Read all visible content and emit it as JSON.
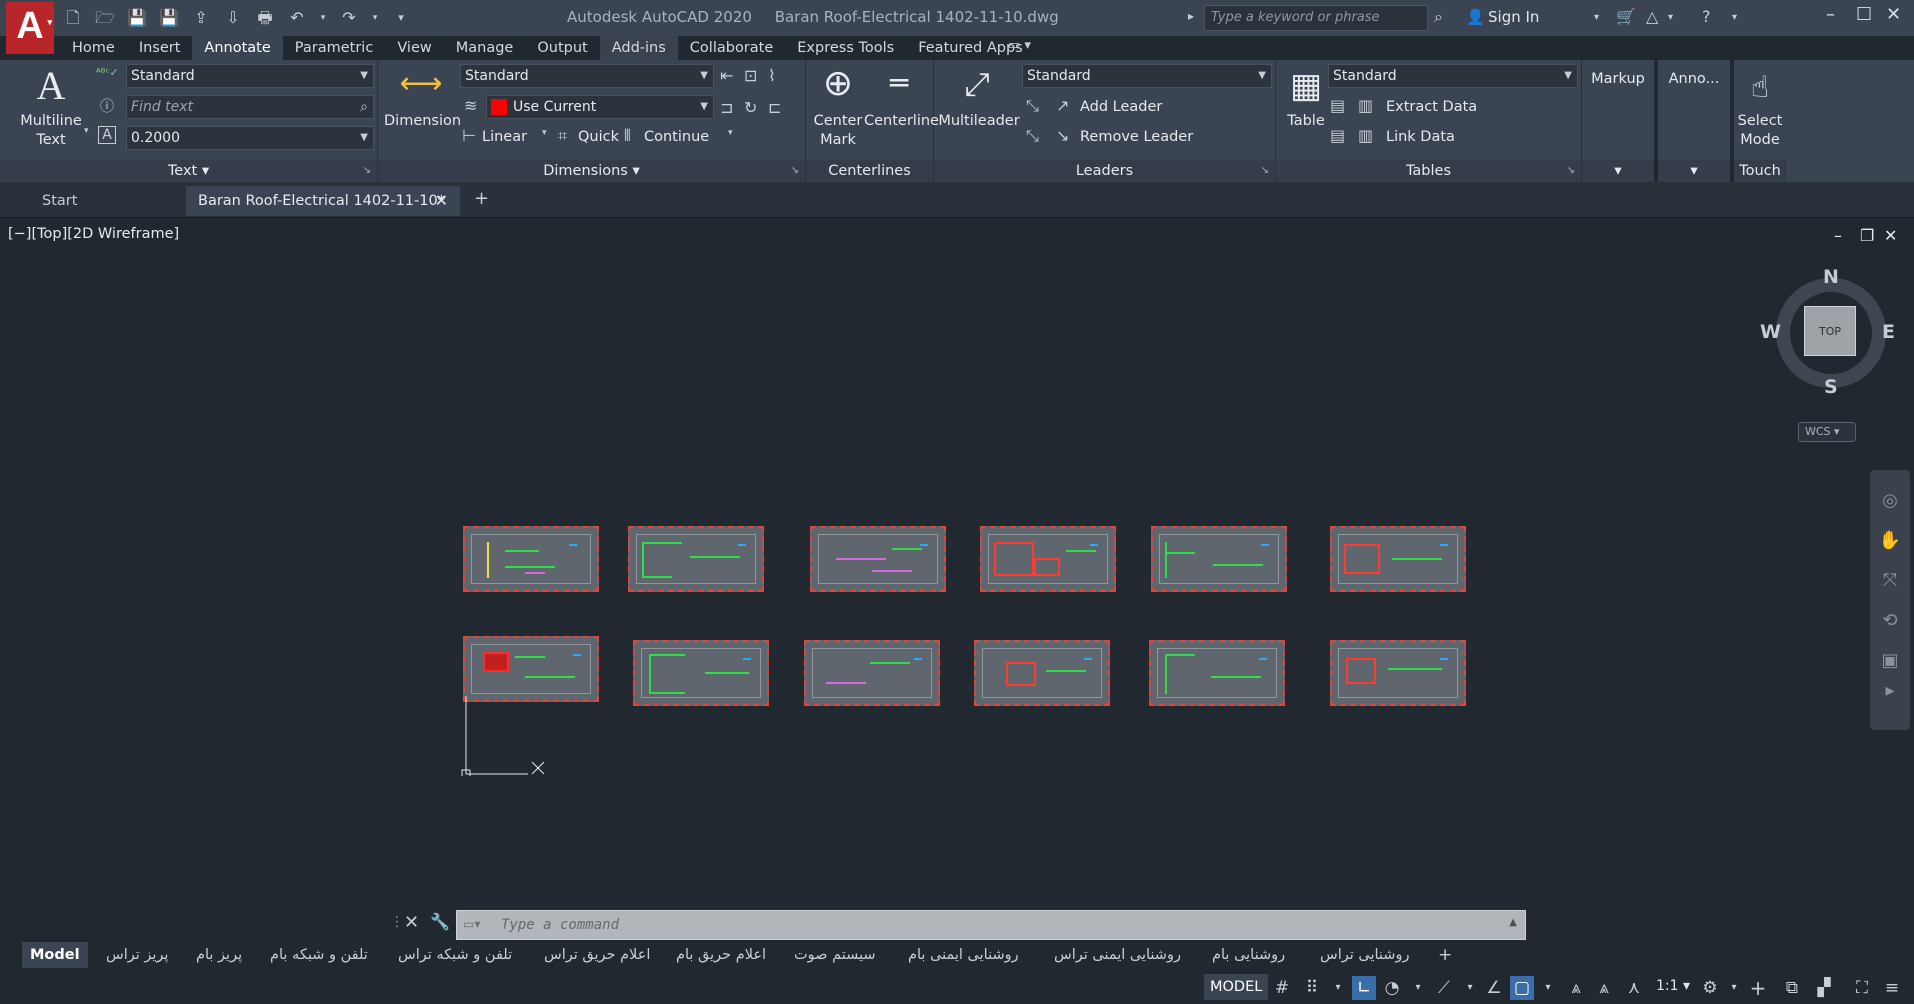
{
  "app": {
    "title": "Autodesk AutoCAD 2020",
    "filename": "Baran Roof-Electrical 1402-11-10.dwg",
    "logo": "A",
    "search_placeholder": "Type a keyword or phrase",
    "signin": "Sign In"
  },
  "ribbon_tabs": [
    "Home",
    "Insert",
    "Annotate",
    "Parametric",
    "View",
    "Manage",
    "Output",
    "Add-ins",
    "Collaborate",
    "Express Tools",
    "Featured Apps"
  ],
  "ribbon_tabs_active": "Annotate",
  "text_panel": {
    "title": "Text",
    "multiline_label": "Multiline\nText",
    "multiline_line1": "Multiline",
    "multiline_line2": "Text",
    "style": "Standard",
    "find_placeholder": "Find text",
    "height": "0.2000"
  },
  "dimensions_panel": {
    "title": "Dimensions",
    "dimension_label": "Dimension",
    "style": "Standard",
    "layer": "Use Current",
    "linear": "Linear",
    "quick": "Quick",
    "continue": "Continue",
    "layer_color": "#ff0000"
  },
  "centerlines_panel": {
    "title": "Centerlines",
    "center_mark_line1": "Center",
    "center_mark_line2": "Mark",
    "centerline": "Centerline"
  },
  "leaders_panel": {
    "title": "Leaders",
    "multileader": "Multileader",
    "style": "Standard",
    "add_leader": "Add Leader",
    "remove_leader": "Remove Leader"
  },
  "tables_panel": {
    "title": "Tables",
    "table": "Table",
    "style": "Standard",
    "extract_data": "Extract Data",
    "link_data": "Link Data"
  },
  "markup_panel": {
    "title": "Markup"
  },
  "anno_panel": {
    "title": "Anno..."
  },
  "touch_panel": {
    "title": "Touch",
    "select_line1": "Select",
    "select_line2": "Mode"
  },
  "file_tabs": {
    "start": "Start",
    "doc": "Baran Roof-Electrical 1402-11-10*"
  },
  "viewport": {
    "label": "[−][Top][2D Wireframe]",
    "viewcube": {
      "north": "N",
      "south": "S",
      "east": "E",
      "west": "W",
      "face": "TOP"
    },
    "wcs": "WCS"
  },
  "command": {
    "placeholder": "Type a command"
  },
  "layout_tabs": [
    "Model",
    "پریز تراس",
    "پریز بام",
    "تلفن و شبکه بام",
    "تلفن و شبکه تراس",
    "اعلام حریق تراس",
    "اعلام حریق بام",
    "سیستم صوت",
    "روشنایی ایمنی بام",
    "روشنایی ایمنی تراس",
    "روشنایی بام",
    "روشنایی تراس"
  ],
  "status": {
    "model": "MODEL",
    "scale": "1:1"
  },
  "colors": {
    "background": "#212830",
    "ribbon": "#3b4453",
    "accent_red": "#b9262a",
    "sheet_border": "#e0443c",
    "sheet_green": "#2fdc4a"
  }
}
